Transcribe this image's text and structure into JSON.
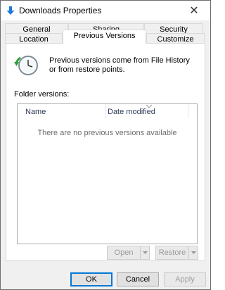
{
  "window": {
    "title": "Downloads Properties"
  },
  "close_label": "✕",
  "tabs": {
    "row_top": [
      "General",
      "Sharing",
      "Security"
    ],
    "row_bottom": [
      "Location",
      "Previous Versions",
      "Customize"
    ],
    "active": "Previous Versions"
  },
  "panel": {
    "description": "Previous versions come from File History or from restore points.",
    "folder_versions_label": "Folder versions:",
    "columns": [
      "Name",
      "Date modified"
    ],
    "empty_message": "There are no previous versions available",
    "open_button": "Open",
    "restore_button": "Restore"
  },
  "footer": {
    "ok": "OK",
    "cancel": "Cancel",
    "apply": "Apply"
  },
  "colors": {
    "accent": "#0078d7",
    "panel_bg": "#ffffff",
    "window_bg": "#f0f0f0",
    "disabled_text": "#a0a0a0"
  },
  "icons": {
    "title": "download-arrow-icon",
    "history": "clock-restore-icon"
  }
}
